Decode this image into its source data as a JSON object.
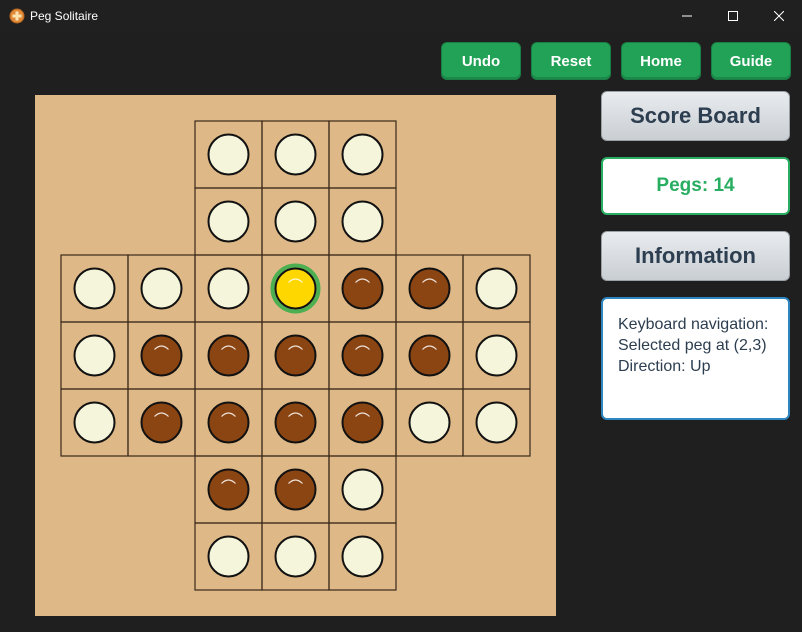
{
  "window": {
    "title": "Peg Solitaire",
    "icon": "app-icon",
    "controls": [
      "minimize-icon",
      "maximize-icon",
      "close-icon"
    ]
  },
  "toolbar": {
    "undo_label": "Undo",
    "reset_label": "Reset",
    "home_label": "Home",
    "guide_label": "Guide"
  },
  "sidebar": {
    "scoreboard_label": "Score Board",
    "pegs_text": "Pegs: 14",
    "information_label": "Information",
    "info_lines": [
      "Keyboard navigation:",
      "Selected peg at (2,3)",
      "Direction: Up"
    ]
  },
  "board": {
    "layout_rows": [
      "..ooo..",
      "..ooo..",
      "ooooooo",
      "ooooooo",
      "ooooooo",
      "..ooo..",
      "..ooo.."
    ],
    "state_rows": [
      "..EEE..",
      "..EEE..",
      "EEESPPE",
      "EPPPPPE",
      "EPPPPEE",
      "..PPE..",
      "..EEE.."
    ],
    "legend": {
      "E": "empty-hole",
      "P": "peg",
      "S": "selected-peg"
    },
    "colors": {
      "board": "#deb887",
      "empty_hole": "#f5f5dc",
      "peg": "#8b4513",
      "selected_peg": "#ffd700",
      "selected_ring": "#4caf50",
      "grid_line": "#3a2a1a"
    }
  },
  "theme": {
    "window_bg": "#1f1f1f",
    "button_green": "#22a257",
    "score_text": "#27ae60",
    "info_border": "#2e86c1"
  }
}
